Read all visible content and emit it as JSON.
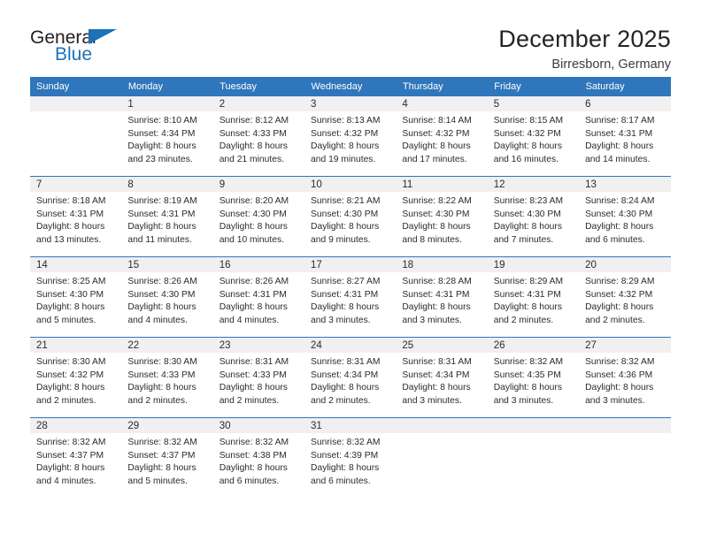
{
  "logo": {
    "word_one": "General",
    "word_two": "Blue",
    "triangle_color": "#1c72b8"
  },
  "header": {
    "month_title": "December 2025",
    "location": "Birresborn, Germany"
  },
  "theme": {
    "header_blue": "#2f76bc",
    "daynum_gray": "#f0f0f0",
    "text": "#2b2b2b"
  },
  "calendar": {
    "weekday_headers": [
      "Sunday",
      "Monday",
      "Tuesday",
      "Wednesday",
      "Thursday",
      "Friday",
      "Saturday"
    ],
    "weeks": [
      [
        {
          "day": ""
        },
        {
          "day": "1",
          "sunrise": "Sunrise: 8:10 AM",
          "sunset": "Sunset: 4:34 PM",
          "daylight_line1": "Daylight: 8 hours",
          "daylight_line2": "and 23 minutes."
        },
        {
          "day": "2",
          "sunrise": "Sunrise: 8:12 AM",
          "sunset": "Sunset: 4:33 PM",
          "daylight_line1": "Daylight: 8 hours",
          "daylight_line2": "and 21 minutes."
        },
        {
          "day": "3",
          "sunrise": "Sunrise: 8:13 AM",
          "sunset": "Sunset: 4:32 PM",
          "daylight_line1": "Daylight: 8 hours",
          "daylight_line2": "and 19 minutes."
        },
        {
          "day": "4",
          "sunrise": "Sunrise: 8:14 AM",
          "sunset": "Sunset: 4:32 PM",
          "daylight_line1": "Daylight: 8 hours",
          "daylight_line2": "and 17 minutes."
        },
        {
          "day": "5",
          "sunrise": "Sunrise: 8:15 AM",
          "sunset": "Sunset: 4:32 PM",
          "daylight_line1": "Daylight: 8 hours",
          "daylight_line2": "and 16 minutes."
        },
        {
          "day": "6",
          "sunrise": "Sunrise: 8:17 AM",
          "sunset": "Sunset: 4:31 PM",
          "daylight_line1": "Daylight: 8 hours",
          "daylight_line2": "and 14 minutes."
        }
      ],
      [
        {
          "day": "7",
          "sunrise": "Sunrise: 8:18 AM",
          "sunset": "Sunset: 4:31 PM",
          "daylight_line1": "Daylight: 8 hours",
          "daylight_line2": "and 13 minutes."
        },
        {
          "day": "8",
          "sunrise": "Sunrise: 8:19 AM",
          "sunset": "Sunset: 4:31 PM",
          "daylight_line1": "Daylight: 8 hours",
          "daylight_line2": "and 11 minutes."
        },
        {
          "day": "9",
          "sunrise": "Sunrise: 8:20 AM",
          "sunset": "Sunset: 4:30 PM",
          "daylight_line1": "Daylight: 8 hours",
          "daylight_line2": "and 10 minutes."
        },
        {
          "day": "10",
          "sunrise": "Sunrise: 8:21 AM",
          "sunset": "Sunset: 4:30 PM",
          "daylight_line1": "Daylight: 8 hours",
          "daylight_line2": "and 9 minutes."
        },
        {
          "day": "11",
          "sunrise": "Sunrise: 8:22 AM",
          "sunset": "Sunset: 4:30 PM",
          "daylight_line1": "Daylight: 8 hours",
          "daylight_line2": "and 8 minutes."
        },
        {
          "day": "12",
          "sunrise": "Sunrise: 8:23 AM",
          "sunset": "Sunset: 4:30 PM",
          "daylight_line1": "Daylight: 8 hours",
          "daylight_line2": "and 7 minutes."
        },
        {
          "day": "13",
          "sunrise": "Sunrise: 8:24 AM",
          "sunset": "Sunset: 4:30 PM",
          "daylight_line1": "Daylight: 8 hours",
          "daylight_line2": "and 6 minutes."
        }
      ],
      [
        {
          "day": "14",
          "sunrise": "Sunrise: 8:25 AM",
          "sunset": "Sunset: 4:30 PM",
          "daylight_line1": "Daylight: 8 hours",
          "daylight_line2": "and 5 minutes."
        },
        {
          "day": "15",
          "sunrise": "Sunrise: 8:26 AM",
          "sunset": "Sunset: 4:30 PM",
          "daylight_line1": "Daylight: 8 hours",
          "daylight_line2": "and 4 minutes."
        },
        {
          "day": "16",
          "sunrise": "Sunrise: 8:26 AM",
          "sunset": "Sunset: 4:31 PM",
          "daylight_line1": "Daylight: 8 hours",
          "daylight_line2": "and 4 minutes."
        },
        {
          "day": "17",
          "sunrise": "Sunrise: 8:27 AM",
          "sunset": "Sunset: 4:31 PM",
          "daylight_line1": "Daylight: 8 hours",
          "daylight_line2": "and 3 minutes."
        },
        {
          "day": "18",
          "sunrise": "Sunrise: 8:28 AM",
          "sunset": "Sunset: 4:31 PM",
          "daylight_line1": "Daylight: 8 hours",
          "daylight_line2": "and 3 minutes."
        },
        {
          "day": "19",
          "sunrise": "Sunrise: 8:29 AM",
          "sunset": "Sunset: 4:31 PM",
          "daylight_line1": "Daylight: 8 hours",
          "daylight_line2": "and 2 minutes."
        },
        {
          "day": "20",
          "sunrise": "Sunrise: 8:29 AM",
          "sunset": "Sunset: 4:32 PM",
          "daylight_line1": "Daylight: 8 hours",
          "daylight_line2": "and 2 minutes."
        }
      ],
      [
        {
          "day": "21",
          "sunrise": "Sunrise: 8:30 AM",
          "sunset": "Sunset: 4:32 PM",
          "daylight_line1": "Daylight: 8 hours",
          "daylight_line2": "and 2 minutes."
        },
        {
          "day": "22",
          "sunrise": "Sunrise: 8:30 AM",
          "sunset": "Sunset: 4:33 PM",
          "daylight_line1": "Daylight: 8 hours",
          "daylight_line2": "and 2 minutes."
        },
        {
          "day": "23",
          "sunrise": "Sunrise: 8:31 AM",
          "sunset": "Sunset: 4:33 PM",
          "daylight_line1": "Daylight: 8 hours",
          "daylight_line2": "and 2 minutes."
        },
        {
          "day": "24",
          "sunrise": "Sunrise: 8:31 AM",
          "sunset": "Sunset: 4:34 PM",
          "daylight_line1": "Daylight: 8 hours",
          "daylight_line2": "and 2 minutes."
        },
        {
          "day": "25",
          "sunrise": "Sunrise: 8:31 AM",
          "sunset": "Sunset: 4:34 PM",
          "daylight_line1": "Daylight: 8 hours",
          "daylight_line2": "and 3 minutes."
        },
        {
          "day": "26",
          "sunrise": "Sunrise: 8:32 AM",
          "sunset": "Sunset: 4:35 PM",
          "daylight_line1": "Daylight: 8 hours",
          "daylight_line2": "and 3 minutes."
        },
        {
          "day": "27",
          "sunrise": "Sunrise: 8:32 AM",
          "sunset": "Sunset: 4:36 PM",
          "daylight_line1": "Daylight: 8 hours",
          "daylight_line2": "and 3 minutes."
        }
      ],
      [
        {
          "day": "28",
          "sunrise": "Sunrise: 8:32 AM",
          "sunset": "Sunset: 4:37 PM",
          "daylight_line1": "Daylight: 8 hours",
          "daylight_line2": "and 4 minutes."
        },
        {
          "day": "29",
          "sunrise": "Sunrise: 8:32 AM",
          "sunset": "Sunset: 4:37 PM",
          "daylight_line1": "Daylight: 8 hours",
          "daylight_line2": "and 5 minutes."
        },
        {
          "day": "30",
          "sunrise": "Sunrise: 8:32 AM",
          "sunset": "Sunset: 4:38 PM",
          "daylight_line1": "Daylight: 8 hours",
          "daylight_line2": "and 6 minutes."
        },
        {
          "day": "31",
          "sunrise": "Sunrise: 8:32 AM",
          "sunset": "Sunset: 4:39 PM",
          "daylight_line1": "Daylight: 8 hours",
          "daylight_line2": "and 6 minutes."
        },
        {
          "day": ""
        },
        {
          "day": ""
        },
        {
          "day": ""
        }
      ]
    ]
  }
}
